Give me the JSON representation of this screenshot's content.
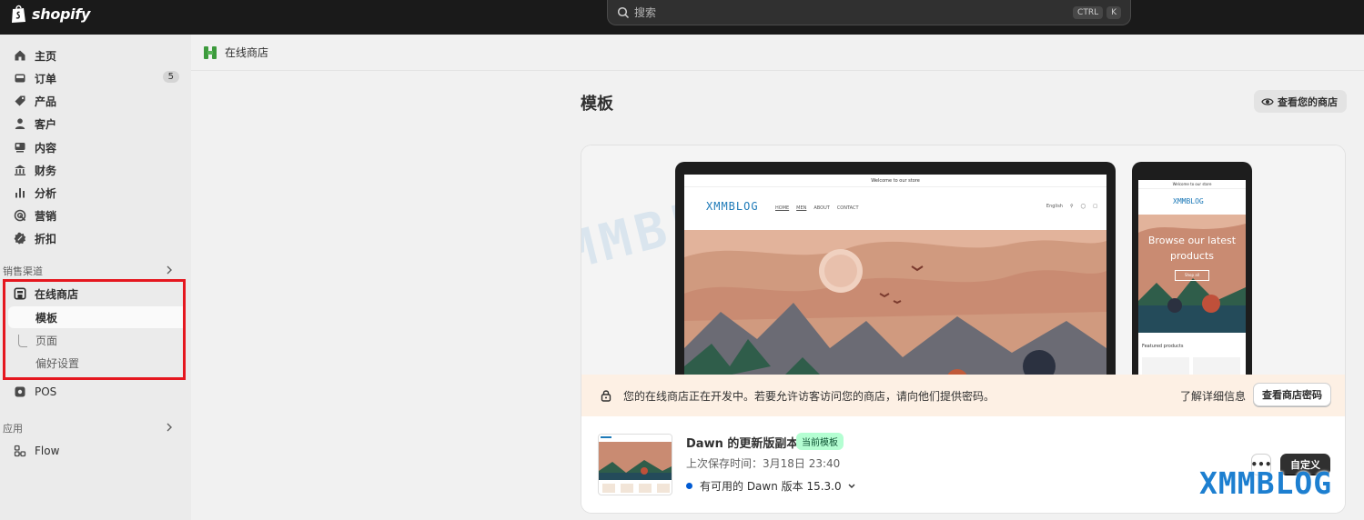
{
  "topbar": {
    "logo_text": "shopify",
    "search_placeholder": "搜索",
    "shortcut_keys": [
      "CTRL",
      "K"
    ]
  },
  "sidebar": {
    "items": [
      {
        "label": "主页",
        "icon": "home-icon"
      },
      {
        "label": "订单",
        "icon": "inbox-icon",
        "badge": "5"
      },
      {
        "label": "产品",
        "icon": "tag-icon"
      },
      {
        "label": "客户",
        "icon": "person-icon"
      },
      {
        "label": "内容",
        "icon": "content-icon"
      },
      {
        "label": "财务",
        "icon": "bank-icon"
      },
      {
        "label": "分析",
        "icon": "bar-chart-icon"
      },
      {
        "label": "营销",
        "icon": "target-icon"
      },
      {
        "label": "折扣",
        "icon": "discount-icon"
      }
    ],
    "sales_channels_heading": "销售渠道",
    "online_store": {
      "label": "在线商店",
      "icon": "storefront-icon",
      "sub_items": [
        "模板",
        "页面",
        "偏好设置"
      ],
      "active_sub": "模板"
    },
    "pos": {
      "label": "POS",
      "icon": "pos-icon"
    },
    "apps_heading": "应用",
    "flow": {
      "label": "Flow",
      "icon": "flow-icon"
    }
  },
  "breadcrumb": {
    "label": "在线商店"
  },
  "page": {
    "title": "模板",
    "view_store_button": "查看您的商店"
  },
  "preview": {
    "laptop": {
      "announcement": "Welcome to our store",
      "logo": "XMMBLOG",
      "nav": [
        "HOME",
        "MEN",
        "ABOUT",
        "CONTACT"
      ],
      "language": "English"
    },
    "phone": {
      "announcement": "Welcome to our store",
      "logo": "XMMBLOG",
      "hero_text": "Browse our latest products",
      "shop_button": "Shop all",
      "featured": "Featured products"
    },
    "watermark": "XMMBLOG"
  },
  "notice": {
    "text": "您的在线商店正在开发中。若要允许访客访问您的商店，请向他们提供密码。",
    "learn_more": "了解详细信息",
    "password_button": "查看商店密码"
  },
  "theme": {
    "name": "Dawn 的更新版副本",
    "badge": "当前模板",
    "last_saved": "上次保存时间：3月18日 23:40",
    "update_text": "有可用的 Dawn 版本 15.3.0",
    "more_button": "•••",
    "customize_button": "自定义"
  },
  "corner_watermark": "XMMBLOG",
  "colors": {
    "topbar": "#1a1a1a",
    "sidebar": "#ebebeb",
    "highlight_box": "#e5171f",
    "notice_bg": "#fdf0e4",
    "badge_green": "#b4fed2",
    "update_dot": "#005bd3",
    "watermark_blue": "#1d7fd0"
  }
}
